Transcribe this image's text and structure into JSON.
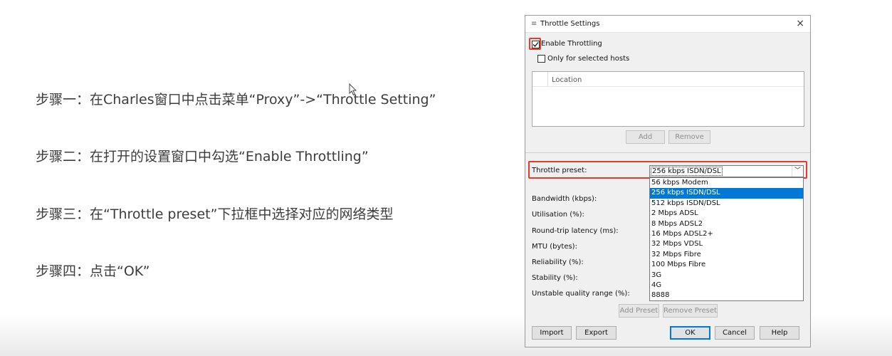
{
  "steps": [
    "步骤一：在Charles窗口中点击菜单“Proxy”->“Throttle Setting”",
    "步骤二：在打开的设置窗口中勾选“Enable Throttling”",
    "步骤三：在“Throttle preset”下拉框中选择对应的网络类型",
    "步骤四：点击“OK”"
  ],
  "dialog": {
    "title": "Throttle Settings",
    "close_glyph": "×",
    "enable_throttling": {
      "label": "Enable Throttling",
      "checked": true
    },
    "only_selected_hosts": {
      "label": "Only for selected hosts",
      "checked": false
    },
    "hosts_table": {
      "column": "Location"
    },
    "add_label": "Add",
    "remove_label": "Remove",
    "preset_label": "Throttle preset:",
    "preset_value": "256 kbps ISDN/DSL",
    "preset_options": [
      "56 kbps Modem",
      "256 kbps ISDN/DSL",
      "512 kbps ISDN/DSL",
      "2 Mbps ADSL",
      "8 Mbps ADSL2",
      "16 Mbps ADSL2+",
      "32 Mbps VDSL",
      "32 Mbps Fibre",
      "100 Mbps Fibre",
      "3G",
      "4G",
      "8888"
    ],
    "selected_option_index": 1,
    "fields": [
      "Bandwidth (kbps):",
      "Utilisation (%):",
      "Round-trip latency (ms):",
      "MTU (bytes):",
      "Reliability (%):",
      "Stability (%):",
      "Unstable quality range (%):"
    ],
    "add_preset_label": "Add Preset",
    "remove_preset_label": "Remove Preset",
    "import_label": "Import",
    "export_label": "Export",
    "ok_label": "OK",
    "cancel_label": "Cancel",
    "help_label": "Help"
  },
  "colors": {
    "highlight_red": "#e53b2a",
    "selection_blue": "#0078d7"
  }
}
